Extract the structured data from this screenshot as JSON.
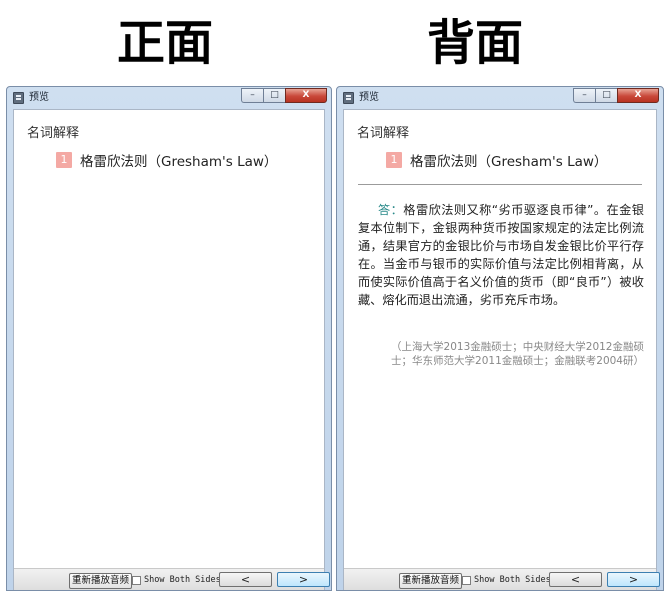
{
  "headings": {
    "front": "正面",
    "back": "背面"
  },
  "window": {
    "title": "预览",
    "minimize_glyph": "–",
    "maximize_glyph": "□",
    "close_glyph": "X"
  },
  "card": {
    "category": "名词解释",
    "number": "1",
    "term": "格雷欣法则（Gresham's Law）",
    "answer_label": "答：",
    "answer_text": "格雷欣法则又称“劣币驱逐良币律”。在金银复本位制下，金银两种货币按国家规定的法定比例流通，结果官方的金银比价与市场自发金银比价平行存在。当金币与银币的实际价值与法定比例相背离，从而使实际价值高于名义价值的货币（即“良币”）被收藏、熔化而退出流通，劣币充斥市场。",
    "source": "（上海大学2013金融硕士；中央财经大学2012金融硕士；华东师范大学2011金融硕士；金融联考2004研）"
  },
  "bottombar": {
    "replay_label": "重新播放音频",
    "show_both_label": "Show Both Sides",
    "prev_label": "<",
    "next_label": ">"
  }
}
